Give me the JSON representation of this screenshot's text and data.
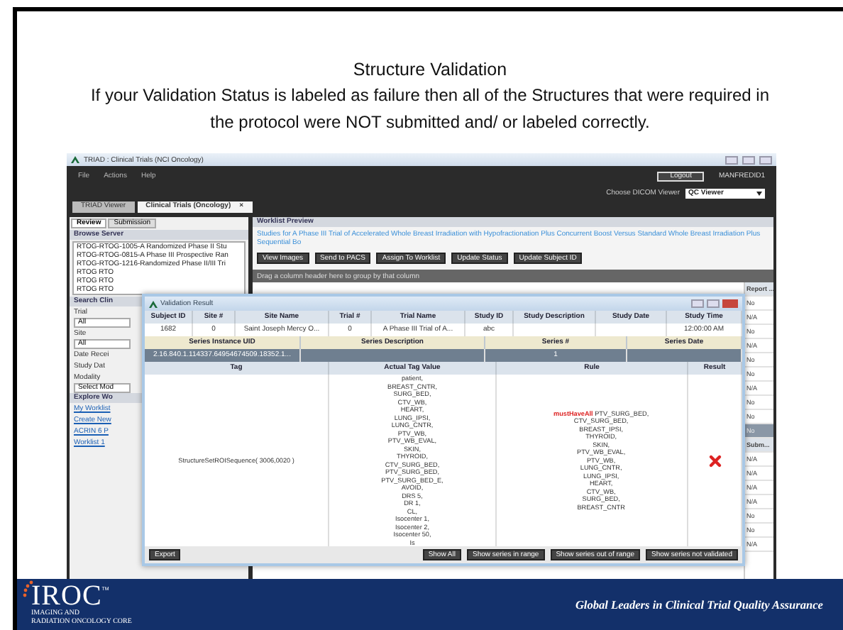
{
  "slide": {
    "title": "Structure Validation",
    "text": "If your Validation Status is  labeled as failure then all of the Structures that were required in the protocol were NOT  submitted and/ or  labeled correctly."
  },
  "window": {
    "title": "TRIAD : Clinical Trials (NCI Oncology)"
  },
  "menu": [
    "File",
    "Actions",
    "Help"
  ],
  "logout": "Logout",
  "user": "MANFREDID1",
  "viewer_label": "Choose DICOM Viewer",
  "viewer_value": "QC Viewer",
  "tabs": [
    {
      "label": "TRIAD Viewer",
      "selected": false
    },
    {
      "label": "Clinical Trials (Oncology)",
      "selected": true,
      "close": "×"
    }
  ],
  "left_tabs": [
    {
      "label": "Review",
      "selected": true
    },
    {
      "label": "Submission",
      "selected": false
    }
  ],
  "browse": {
    "title": "Browse Server",
    "items": [
      "RTOG-RTOG-1005-A Randomized Phase II Stu",
      "RTOG-RTOG-0815-A Phase III Prospective Ran",
      "RTOG-RTOG-1216-Randomized Phase II/III Tri",
      "RTOG RTO",
      "RTOG RTO",
      "RTOG RTO"
    ]
  },
  "search": {
    "title": "Search Clin",
    "fields": [
      {
        "label": "Trial",
        "value": "All"
      },
      {
        "label": "Site",
        "value": "All"
      },
      {
        "label": "Date Recei"
      },
      {
        "label": "Study Dat"
      },
      {
        "label": "Modality",
        "value": "Select Mod"
      }
    ]
  },
  "explore": {
    "title": "Explore Wo",
    "items": [
      "My Worklist",
      "Create New",
      "ACRIN 6 P",
      "Worklist 1"
    ]
  },
  "worklist": {
    "title": "Worklist Preview",
    "link": "Studies for A Phase III Trial of Accelerated Whole Breast Irradiation with Hypofractionation Plus Concurrent Boost Versus Standard Whole Breast Irradiation Plus Sequential Bo",
    "buttons": [
      "View Images",
      "Send to PACS",
      "Assign To Worklist",
      "Update Status",
      "Update Subject ID"
    ],
    "group_hint": "Drag a column header here to group by that column",
    "report": [
      {
        "text": "Report ...",
        "kind": "header",
        "selected": false
      },
      {
        "text": "No",
        "kind": "cell",
        "selected": false
      },
      {
        "text": "N/A",
        "kind": "cell",
        "selected": false
      },
      {
        "text": "No",
        "kind": "cell",
        "selected": false
      },
      {
        "text": "N/A",
        "kind": "cell",
        "selected": false
      },
      {
        "text": "No",
        "kind": "cell",
        "selected": false
      },
      {
        "text": "No",
        "kind": "cell",
        "selected": false
      },
      {
        "text": "N/A",
        "kind": "cell",
        "selected": false
      },
      {
        "text": "No",
        "kind": "cell",
        "selected": false
      },
      {
        "text": "No",
        "kind": "cell",
        "selected": false
      },
      {
        "text": "No",
        "kind": "cell",
        "selected": true
      },
      {
        "text": "Subm...",
        "kind": "header",
        "selected": false
      },
      {
        "text": "N/A",
        "kind": "cell",
        "selected": false
      },
      {
        "text": "N/A",
        "kind": "cell",
        "selected": false
      },
      {
        "text": "N/A",
        "kind": "cell",
        "selected": false
      },
      {
        "text": "N/A",
        "kind": "cell",
        "selected": false
      },
      {
        "text": "No",
        "kind": "cell",
        "selected": false
      },
      {
        "text": "No",
        "kind": "cell",
        "selected": false
      },
      {
        "text": "N/A",
        "kind": "cell",
        "selected": false
      }
    ]
  },
  "dialog": {
    "title": "Validation Result",
    "study_columns": [
      {
        "header": "Subject ID",
        "value": "1682"
      },
      {
        "header": "Site #",
        "value": "0"
      },
      {
        "header": "Site Name",
        "value": "Saint Joseph Mercy O..."
      },
      {
        "header": "Trial #",
        "value": "0"
      },
      {
        "header": "Trial Name",
        "value": "A Phase III Trial of A..."
      },
      {
        "header": "Study ID",
        "value": "abc"
      },
      {
        "header": "Study Description"
      },
      {
        "header": "Study Date"
      },
      {
        "header": "Study Time",
        "value": "12:00:00 AM"
      }
    ],
    "series_columns": [
      {
        "header": "Series Instance UID",
        "value": "2.16.840.1.114337.64954674509.18352.1..."
      },
      {
        "header": "Series Description"
      },
      {
        "header": "Series #",
        "value": "1"
      },
      {
        "header": "Series Date"
      }
    ],
    "tag_columns": [
      "Tag",
      "Actual Tag Value",
      "Rule",
      "Result"
    ],
    "tag_row": {
      "tag": "StructureSetROISequence( 3006,0020 )",
      "value": "patient,\nBREAST_CNTR,\nSURG_BED,\nCTV_WB,\nHEART,\nLUNG_IPSI,\nLUNG_CNTR,\nPTV_WB,\nPTV_WB_EVAL,\nSKIN,\nTHYROID,\nCTV_SURG_BED,\nPTV_SURG_BED,\nPTV_SURG_BED_E,\nAVOID,\nDRS 5,\nDR 1,\nCL,\nIsocenter 1,\nIsocenter 2,\nIsocenter 50,\nIs",
      "rule_keyword": "mustHaveAll",
      "rule": "PTV_SURG_BED,\nCTV_SURG_BED,\nBREAST_IPSI,\nTHYROID,\nSKIN,\nPTV_WB_EVAL,\nPTV_WB,\nLUNG_CNTR,\nLUNG_IPSI,\nHEART,\nCTV_WB,\nSURG_BED,\nBREAST_CNTR",
      "passed": false
    },
    "export": "Export",
    "filters": [
      "Show All",
      "Show series in range",
      "Show series out of range",
      "Show series not validated"
    ]
  },
  "footer": {
    "logo": "IROC",
    "logo_mark": "TM",
    "logo_sub": "IMAGING AND\nRADIATION ONCOLOGY CORE",
    "tagline": "Global Leaders in Clinical Trial Quality Assurance"
  }
}
